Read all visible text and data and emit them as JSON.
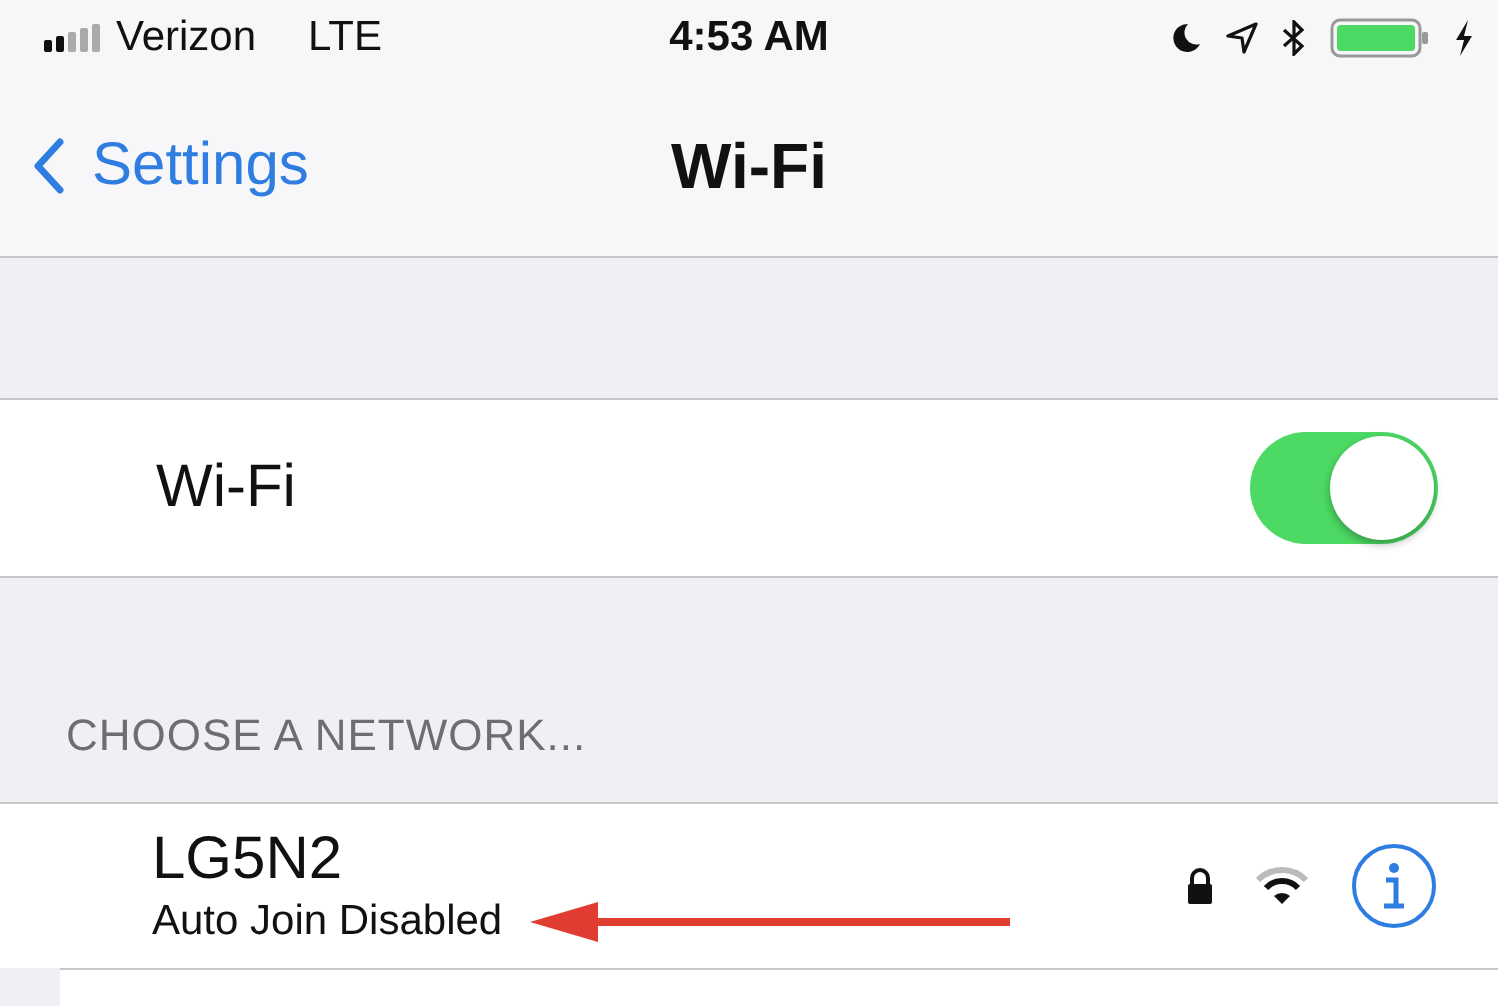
{
  "status_bar": {
    "carrier": "Verizon",
    "network": "LTE",
    "time": "4:53 AM",
    "charging": true
  },
  "nav": {
    "back": "Settings",
    "title": "Wi-Fi"
  },
  "wifi": {
    "label": "Wi-Fi",
    "on": true
  },
  "section_header": "CHOOSE A NETWORK...",
  "networks": [
    {
      "name": "LG5N2",
      "subtitle": "Auto Join Disabled",
      "locked": true
    }
  ]
}
